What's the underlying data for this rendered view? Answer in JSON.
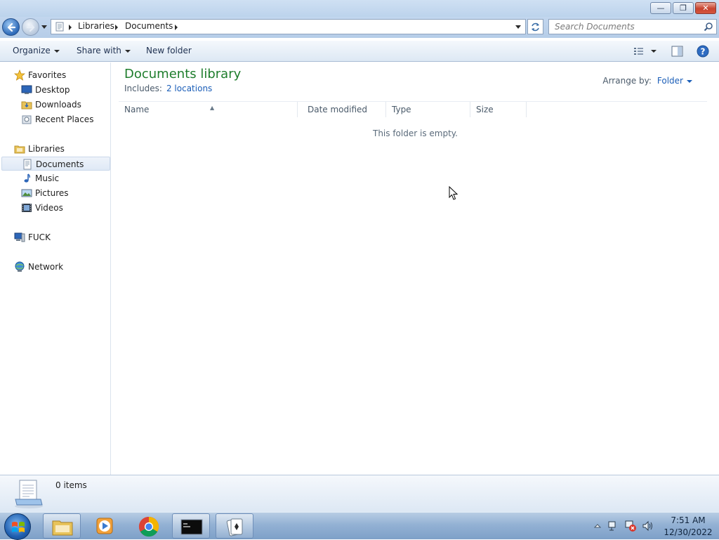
{
  "window": {
    "caption_buttons": {
      "minimize": "—",
      "restore": "❐",
      "close": "✕"
    }
  },
  "address": {
    "crumbs": [
      "Libraries",
      "Documents"
    ],
    "search_placeholder": "Search Documents"
  },
  "toolbar": {
    "organize": "Organize",
    "share_with": "Share with",
    "new_folder": "New folder"
  },
  "nav": {
    "favorites": {
      "label": "Favorites",
      "items": [
        "Desktop",
        "Downloads",
        "Recent Places"
      ]
    },
    "libraries": {
      "label": "Libraries",
      "items": [
        "Documents",
        "Music",
        "Pictures",
        "Videos"
      ]
    },
    "computer": "FUCK",
    "network": "Network"
  },
  "content": {
    "title": "Documents library",
    "includes_label": "Includes:",
    "includes_link": "2 locations",
    "arrange_label": "Arrange by:",
    "arrange_value": "Folder",
    "columns": [
      "Name",
      "Date modified",
      "Type",
      "Size"
    ],
    "empty_message": "This folder is empty."
  },
  "details": {
    "item_count": "0 items"
  },
  "taskbar": {
    "time": "7:51 AM",
    "date": "12/30/2022"
  },
  "colors": {
    "title_green": "#1e7d2c",
    "link_blue": "#1b5eb8",
    "chrome_blue": "#bcd3ec"
  }
}
